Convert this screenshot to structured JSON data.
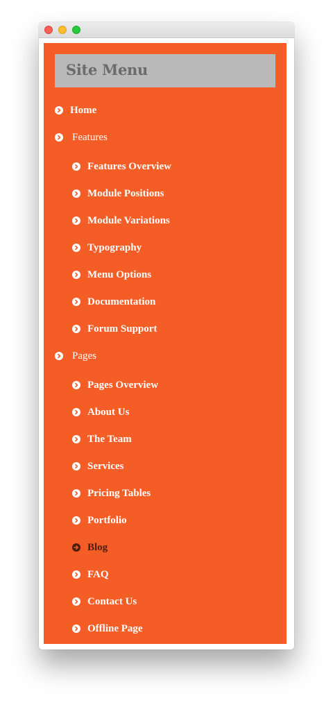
{
  "window": {
    "traffic_lights": [
      {
        "name": "close",
        "color": "#fe5f57"
      },
      {
        "name": "minimize",
        "color": "#febc2e"
      },
      {
        "name": "maximize",
        "color": "#28c840"
      }
    ]
  },
  "theme": {
    "panel_background": "#f55d26",
    "header_background": "#b9b9b9",
    "item_color": "#ffffff",
    "active_item_color": "#4a1f10"
  },
  "menu": {
    "title": "Site Menu",
    "items": [
      {
        "label": "Home",
        "level": 0,
        "active": false,
        "icon": "chevron-right-circle-icon"
      },
      {
        "label": "Features",
        "level": 0,
        "active": false,
        "parent": true,
        "icon": "chevron-right-circle-icon"
      },
      {
        "label": "Features Overview",
        "level": 1,
        "active": false,
        "icon": "chevron-right-circle-icon"
      },
      {
        "label": "Module Positions",
        "level": 1,
        "active": false,
        "icon": "chevron-right-circle-icon"
      },
      {
        "label": "Module Variations",
        "level": 1,
        "active": false,
        "icon": "chevron-right-circle-icon"
      },
      {
        "label": "Typography",
        "level": 1,
        "active": false,
        "icon": "chevron-right-circle-icon"
      },
      {
        "label": "Menu Options",
        "level": 1,
        "active": false,
        "icon": "chevron-right-circle-icon"
      },
      {
        "label": "Documentation",
        "level": 1,
        "active": false,
        "icon": "chevron-right-circle-icon"
      },
      {
        "label": "Forum Support",
        "level": 1,
        "active": false,
        "icon": "chevron-right-circle-icon"
      },
      {
        "label": "Pages",
        "level": 0,
        "active": false,
        "parent": true,
        "icon": "chevron-right-circle-icon"
      },
      {
        "label": "Pages Overview",
        "level": 1,
        "active": false,
        "icon": "chevron-right-circle-icon"
      },
      {
        "label": "About Us",
        "level": 1,
        "active": false,
        "icon": "chevron-right-circle-icon"
      },
      {
        "label": "The Team",
        "level": 1,
        "active": false,
        "icon": "chevron-right-circle-icon"
      },
      {
        "label": "Services",
        "level": 1,
        "active": false,
        "icon": "chevron-right-circle-icon"
      },
      {
        "label": "Pricing Tables",
        "level": 1,
        "active": false,
        "icon": "chevron-right-circle-icon"
      },
      {
        "label": "Portfolio",
        "level": 1,
        "active": false,
        "icon": "chevron-right-circle-icon"
      },
      {
        "label": "Blog",
        "level": 1,
        "active": true,
        "icon": "arrow-right-circle-icon"
      },
      {
        "label": "FAQ",
        "level": 1,
        "active": false,
        "icon": "chevron-right-circle-icon"
      },
      {
        "label": "Contact Us",
        "level": 1,
        "active": false,
        "icon": "chevron-right-circle-icon"
      },
      {
        "label": "Offline Page",
        "level": 1,
        "active": false,
        "icon": "chevron-right-circle-icon"
      }
    ]
  }
}
